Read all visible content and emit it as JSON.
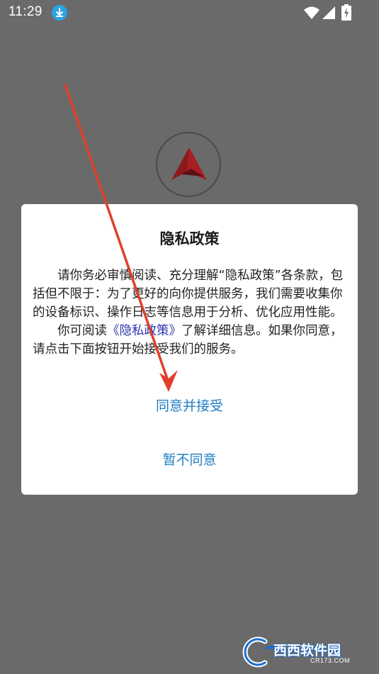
{
  "status_bar": {
    "time": "11:29",
    "icons": [
      "download-icon",
      "wifi-icon",
      "signal-icon",
      "battery-icon"
    ]
  },
  "app": {
    "logo_icon": "red-triangle-logo-icon"
  },
  "dialog": {
    "title": "隐私政策",
    "paragraph1": "请你务必审慎阅读、充分理解“隐私政策”各条款，包括但不限于：为了更好的向你提供服务，我们需要收集你的设备标识、操作日志等信息用于分析、优化应用性能。",
    "paragraph2_before": "你可阅读",
    "paragraph2_link": "《隐私政策》",
    "paragraph2_after": "了解详细信息。如果你同意，请点击下面按钮开始接受我们的服务。",
    "accept_label": "同意并接受",
    "decline_label": "暂不同意"
  },
  "watermark": {
    "text": "西西软件园",
    "sub": "CR173.COM"
  },
  "colors": {
    "overlay": "#6a6a6a",
    "link": "#2a36b0",
    "button_text": "#1f7ec3",
    "annotation_arrow": "#e0402a",
    "logo_red": "#a81e22"
  }
}
